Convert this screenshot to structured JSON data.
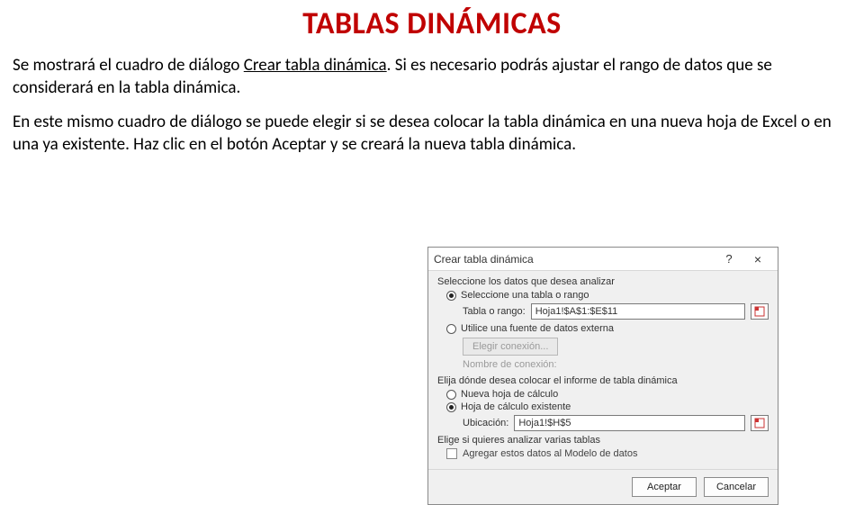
{
  "title": "TABLAS DINÁMICAS",
  "para1_pre": "Se mostrará el cuadro de diálogo ",
  "para1_u": "Crear tabla dinámica",
  "para1_post": ". Si es necesario podrás ajustar el rango de datos que se considerará en la tabla dinámica.",
  "para2": "En este mismo cuadro de diálogo se puede elegir si se desea colocar la tabla dinámica en una nueva hoja de Excel o en una ya existente.  Haz clic en el botón Aceptar y se creará la nueva tabla dinámica.",
  "dialog": {
    "title": "Crear tabla dinámica",
    "help": "?",
    "close": "×",
    "sec1": "Seleccione los datos que desea analizar",
    "opt_range": "Seleccione una tabla o rango",
    "range_label": "Tabla o rango:",
    "range_value": "Hoja1!$A$1:$E$11",
    "opt_ext": "Utilice una fuente de datos externa",
    "btn_conn": "Elegir conexión...",
    "conn_label": "Nombre de conexión:",
    "sec2": "Elija dónde desea colocar el informe de tabla dinámica",
    "opt_new": "Nueva hoja de cálculo",
    "opt_exist": "Hoja de cálculo existente",
    "loc_label": "Ubicación:",
    "loc_value": "Hoja1!$H$5",
    "sec3": "Elige si quieres analizar varias tablas",
    "chk_model": "Agregar estos datos al Modelo de datos",
    "ok": "Aceptar",
    "cancel": "Cancelar"
  }
}
